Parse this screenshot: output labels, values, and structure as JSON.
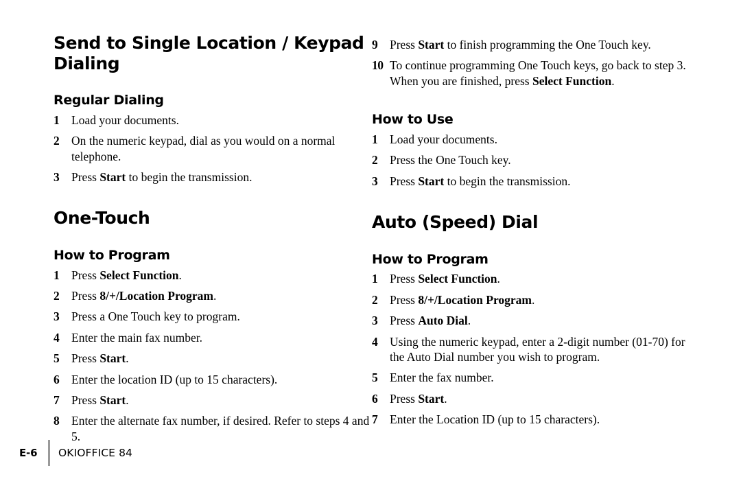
{
  "document": {
    "footer": {
      "page_number": "E-6",
      "product_name": "OKIOFFICE 84"
    }
  },
  "left_column": {
    "title": "Send to Single Location / Keypad Dialing",
    "sections": [
      {
        "heading": "Regular Dialing",
        "steps": [
          {
            "num": "1",
            "html": "Load your documents."
          },
          {
            "num": "2",
            "html": "On the numeric keypad, dial as you would on a normal telephone."
          },
          {
            "num": "3",
            "html": "Press <b>Start</b> to begin the transmission."
          }
        ]
      }
    ],
    "title2": "One-Touch",
    "sections2": [
      {
        "heading": "How to Program",
        "steps": [
          {
            "num": "1",
            "html": "Press <b>Select Function</b>."
          },
          {
            "num": "2",
            "html": "Press <b>8/+/Location Program</b>."
          },
          {
            "num": "3",
            "html": "Press a One Touch key to program."
          },
          {
            "num": "4",
            "html": "Enter the main fax number."
          },
          {
            "num": "5",
            "html": "Press <b>Start</b>."
          },
          {
            "num": "6",
            "html": "Enter the location ID (up to 15 characters)."
          },
          {
            "num": "7",
            "html": "Press <b>Start</b>."
          },
          {
            "num": "8",
            "html": "Enter the alternate fax number, if desired. Refer to steps 4 and 5."
          }
        ]
      }
    ]
  },
  "right_column": {
    "continued_steps": [
      {
        "num": "9",
        "html": "Press <b>Start</b> to finish programming the One Touch key."
      },
      {
        "num": "10",
        "html": "To continue programming One Touch keys, go back to step 3. When you are finished, press <b>Select Function</b>."
      }
    ],
    "sections": [
      {
        "heading": "How to Use",
        "steps": [
          {
            "num": "1",
            "html": "Load your documents."
          },
          {
            "num": "2",
            "html": "Press the One Touch key."
          },
          {
            "num": "3",
            "html": "Press <b>Start</b> to begin the transmission."
          }
        ]
      }
    ],
    "title": "Auto (Speed) Dial",
    "sections2": [
      {
        "heading": "How to Program",
        "steps": [
          {
            "num": "1",
            "html": "Press <b>Select Function</b>."
          },
          {
            "num": "2",
            "html": "Press <b>8/+/Location Program</b>."
          },
          {
            "num": "3",
            "html": "Press <b>Auto Dial</b>."
          },
          {
            "num": "4",
            "html": "Using the numeric keypad, enter a 2-digit number (01-70) for the Auto Dial number you wish to program."
          },
          {
            "num": "5",
            "html": "Enter the fax number."
          },
          {
            "num": "6",
            "html": "Press <b>Start</b>."
          },
          {
            "num": "7",
            "html": "Enter the Location ID (up to 15 characters)."
          }
        ]
      }
    ]
  }
}
